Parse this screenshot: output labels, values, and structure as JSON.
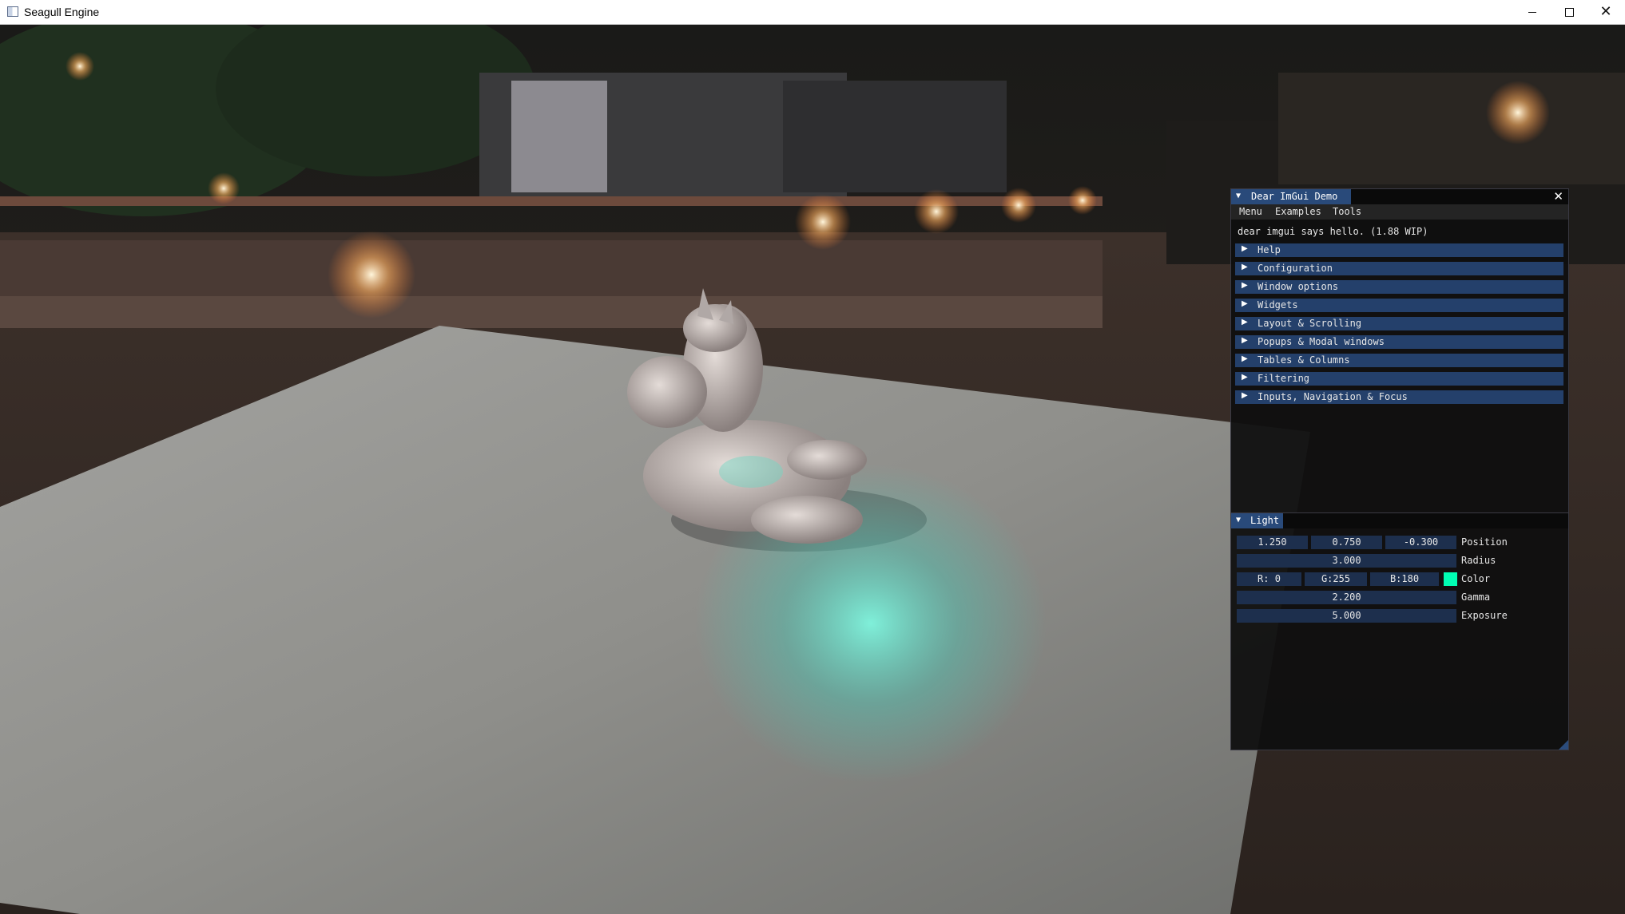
{
  "window": {
    "title": "Seagull Engine"
  },
  "imgui_demo": {
    "title": "Dear ImGui Demo",
    "menu": [
      "Menu",
      "Examples",
      "Tools"
    ],
    "hello": "dear imgui says hello. (1.88 WIP)",
    "headers": [
      "Help",
      "Configuration",
      "Window options",
      "Widgets",
      "Layout & Scrolling",
      "Popups & Modal windows",
      "Tables & Columns",
      "Filtering",
      "Inputs, Navigation & Focus"
    ]
  },
  "light": {
    "title": "Light",
    "position": {
      "x": "1.250",
      "y": "0.750",
      "z": "-0.300",
      "label": "Position"
    },
    "radius": {
      "value": "3.000",
      "label": "Radius"
    },
    "color": {
      "r": "R:  0",
      "g": "G:255",
      "b": "B:180",
      "label": "Color",
      "swatch": "#00ffb4"
    },
    "gamma": {
      "value": "2.200",
      "label": "Gamma"
    },
    "exposure": {
      "value": "5.000",
      "label": "Exposure"
    }
  },
  "colors": {
    "accent": "#294a7a",
    "header": "#24406b",
    "field": "#1d2f4d"
  }
}
